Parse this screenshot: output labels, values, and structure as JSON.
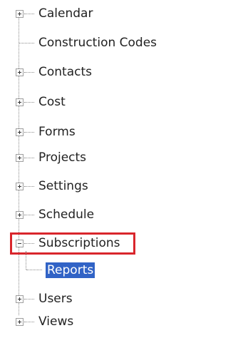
{
  "tree": {
    "items": [
      {
        "label": "Calendar",
        "expander": "plus"
      },
      {
        "label": "Construction Codes",
        "expander": "none"
      },
      {
        "label": "Contacts",
        "expander": "plus"
      },
      {
        "label": "Cost",
        "expander": "plus"
      },
      {
        "label": "Forms",
        "expander": "plus"
      },
      {
        "label": "Projects",
        "expander": "plus"
      },
      {
        "label": "Settings",
        "expander": "plus"
      },
      {
        "label": "Schedule",
        "expander": "plus"
      },
      {
        "label": "Subscriptions",
        "expander": "minus",
        "highlighted": true,
        "children": [
          {
            "label": "Reports",
            "selected": true
          }
        ]
      },
      {
        "label": "Users",
        "expander": "plus"
      },
      {
        "label": "Views",
        "expander": "plus"
      }
    ]
  },
  "colors": {
    "selection_bg": "#3163c6",
    "highlight_border": "#d9262c"
  }
}
